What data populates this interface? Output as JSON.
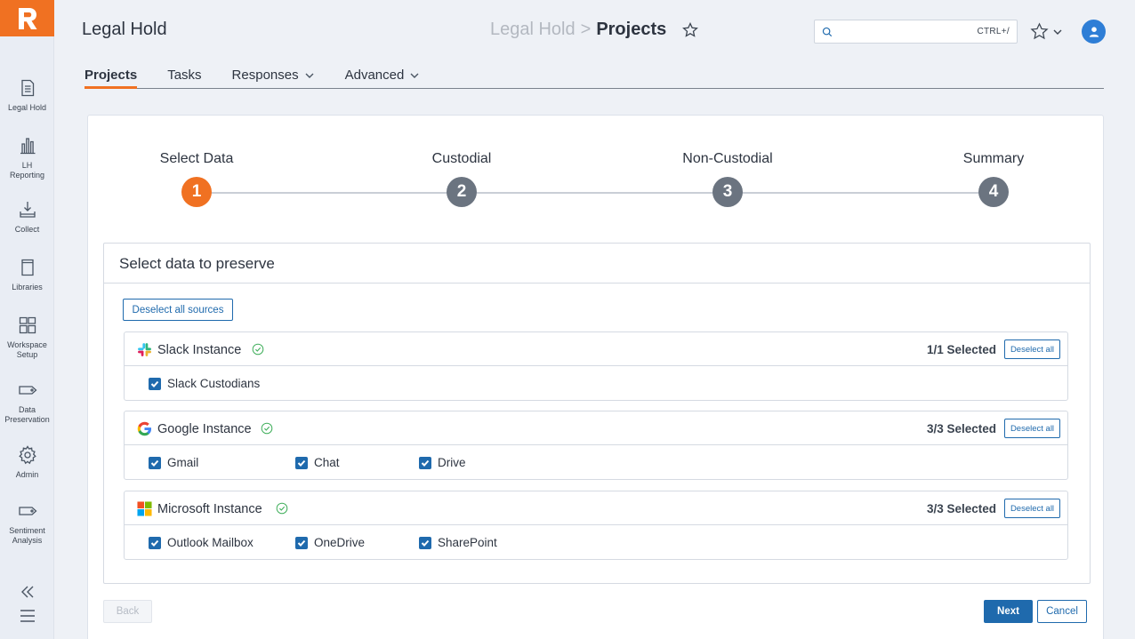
{
  "app": {
    "title": "Legal Hold"
  },
  "breadcrumb": {
    "parent": "Legal Hold",
    "separator": ">",
    "current": "Projects"
  },
  "search": {
    "placeholder": "",
    "shortcut": "CTRL+/"
  },
  "rail": {
    "items": [
      {
        "label": "Legal Hold",
        "icon": "document-icon"
      },
      {
        "label": "LH\nReporting",
        "icon": "bar-chart-icon"
      },
      {
        "label": "Collect",
        "icon": "download-tray-icon"
      },
      {
        "label": "Libraries",
        "icon": "book-icon"
      },
      {
        "label": "Workspace\nSetup",
        "icon": "grid-icon"
      },
      {
        "label": "Data\nPreservation",
        "icon": "tag-icon"
      },
      {
        "label": "Admin",
        "icon": "gear-icon"
      },
      {
        "label": "Sentiment\nAnalysis",
        "icon": "tag-icon"
      }
    ]
  },
  "tabs": [
    {
      "label": "Projects",
      "active": true,
      "dropdown": false
    },
    {
      "label": "Tasks",
      "active": false,
      "dropdown": false
    },
    {
      "label": "Responses",
      "active": false,
      "dropdown": true
    },
    {
      "label": "Advanced",
      "active": false,
      "dropdown": true
    }
  ],
  "steps": [
    {
      "number": "1",
      "label": "Select Data",
      "active": true
    },
    {
      "number": "2",
      "label": "Custodial",
      "active": false
    },
    {
      "number": "3",
      "label": "Non-Custodial",
      "active": false
    },
    {
      "number": "4",
      "label": "Summary",
      "active": false
    }
  ],
  "panel": {
    "title": "Select data to preserve",
    "deselect_all_sources": "Deselect all sources",
    "deselect_all": "Deselect all"
  },
  "sources": [
    {
      "name": "Slack Instance",
      "count": "1/1 Selected",
      "options": [
        "Slack Custodians"
      ]
    },
    {
      "name": "Google Instance",
      "count": "3/3 Selected",
      "options": [
        "Gmail",
        "Chat",
        "Drive"
      ]
    },
    {
      "name": "Microsoft Instance",
      "count": "3/3 Selected",
      "options": [
        "Outlook Mailbox",
        "OneDrive",
        "SharePoint"
      ]
    }
  ],
  "footer": {
    "back": "Back",
    "next": "Next",
    "cancel": "Cancel"
  },
  "colors": {
    "accent": "#f07122",
    "primary": "#1f6aad",
    "step_inactive": "#6b7480",
    "success": "#3fae5a"
  }
}
